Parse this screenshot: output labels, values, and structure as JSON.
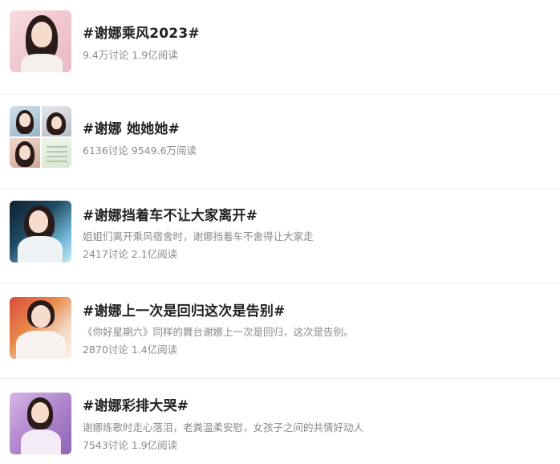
{
  "topics": [
    {
      "title": "#谢娜乘风2023#",
      "desc": "",
      "stats": "9.4万讨论 1.9亿阅读"
    },
    {
      "title": "#谢娜 她她她#",
      "desc": "",
      "stats": "6136讨论 9549.6万阅读"
    },
    {
      "title": "#谢娜挡着车不让大家离开#",
      "desc": "姐姐们离开乘风宿舍时，谢娜挡着车不舍得让大家走",
      "stats": "2417讨论 2.1亿阅读"
    },
    {
      "title": "#谢娜上一次是回归这次是告别#",
      "desc": "《你好星期六》同样的舞台谢娜上一次是回归，这次是告别。",
      "stats": "2870讨论 1.4亿阅读"
    },
    {
      "title": "#谢娜彩排大哭#",
      "desc": "谢娜练歌时走心落泪，老粪温柔安慰，女孩子之间的共情好动人",
      "stats": "7543讨论 1.9亿阅读"
    }
  ],
  "icons": {
    "topic1": "portrait-thumbnail-icon",
    "topic2": "photo-collage-thumbnail-icon",
    "topic3": "portrait-thumbnail-icon",
    "topic4": "portrait-thumbnail-icon",
    "topic5": "portrait-thumbnail-icon"
  },
  "colors": {
    "title": "#222222",
    "meta": "#8a8a8a",
    "separator": "#f0f0f0"
  }
}
